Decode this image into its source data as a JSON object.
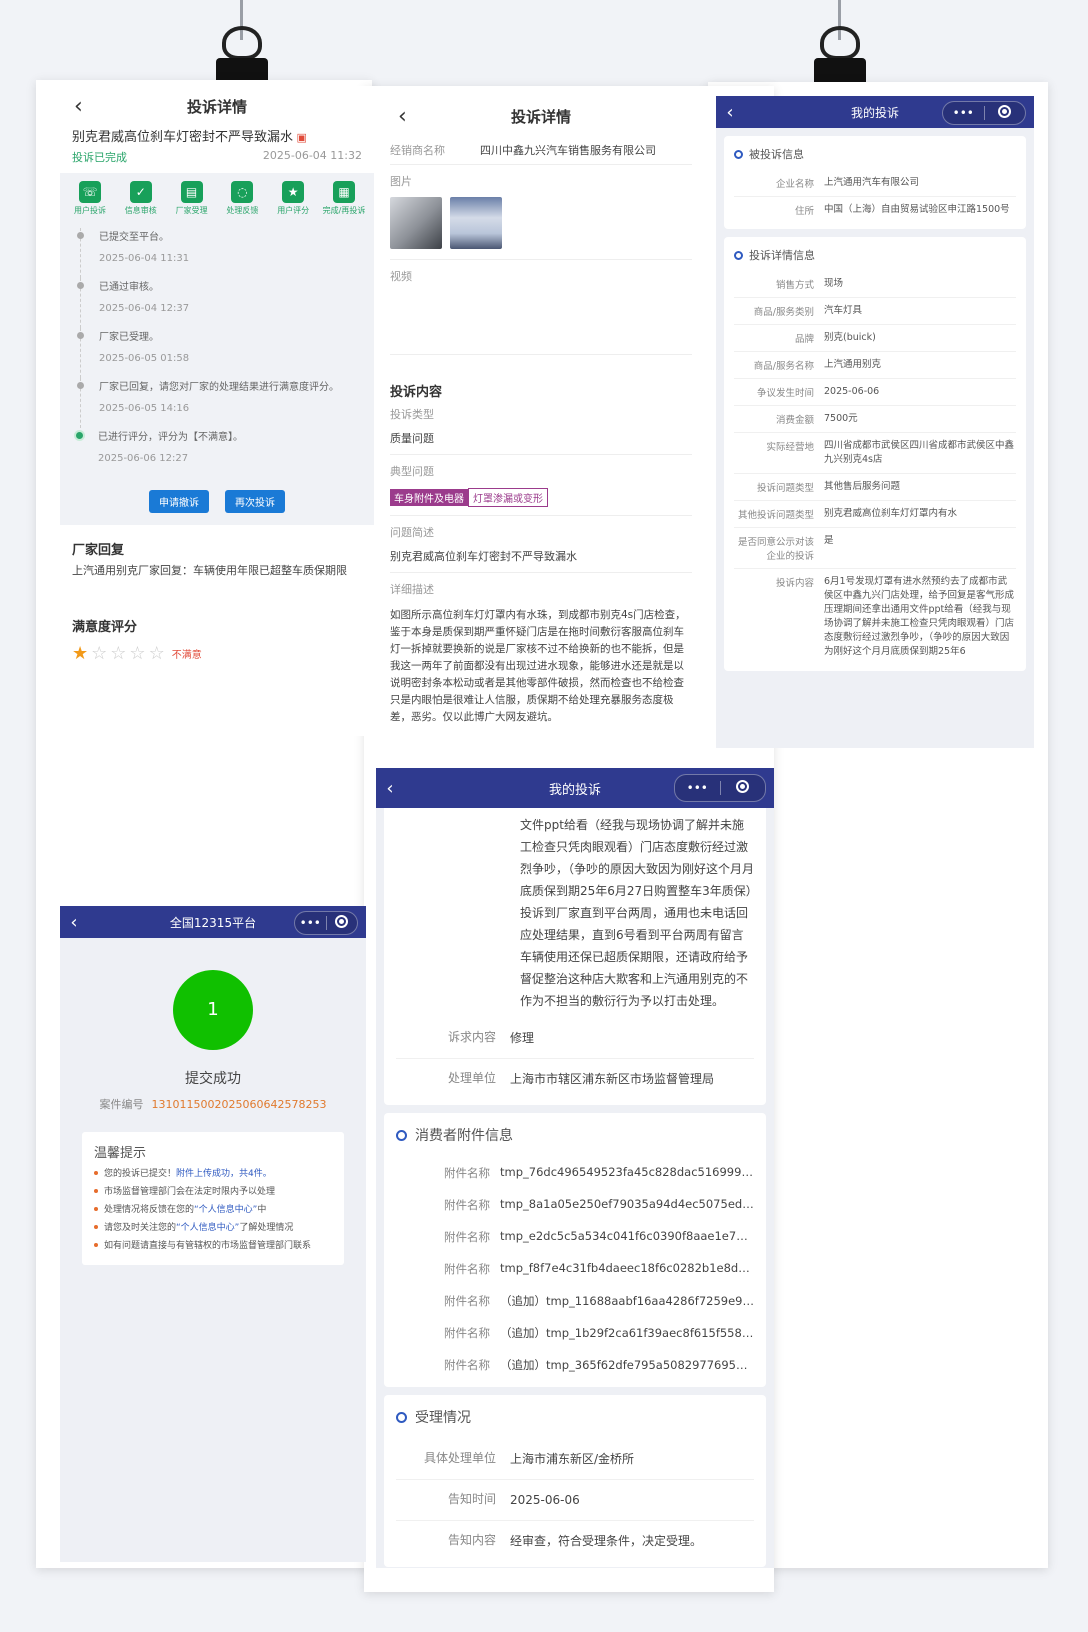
{
  "panel_a": {
    "title": "投诉详情",
    "subject": "别克君威高位刹车灯密封不严导致漏水",
    "status": "投诉已完成",
    "date": "2025-06-04 11:32",
    "steps": [
      "用户投诉",
      "信息审核",
      "厂家受理",
      "处理反馈",
      "用户评分",
      "完成/再投诉"
    ],
    "timeline": [
      {
        "text": "已提交至平台。",
        "time": "2025-06-04 11:31"
      },
      {
        "text": "已通过审核。",
        "time": "2025-06-04 12:37"
      },
      {
        "text": "厂家已受理。",
        "time": "2025-06-05 01:58"
      },
      {
        "text": "厂家已回复，请您对厂家的处理结果进行满意度评分。",
        "time": "2025-06-05 14:16"
      },
      {
        "text": "已进行评分，评分为【不满意】。",
        "time": "2025-06-06 12:27"
      }
    ],
    "btn_apply": "申请撤诉",
    "btn_again": "再次投诉",
    "reply_title": "厂家回复",
    "reply_text": "上汽通用别克厂家回复：车辆使用年限已超整车质保期限",
    "rating_title": "满意度评分",
    "rating_value": 1,
    "rating_max": 5,
    "rating_label": "不满意"
  },
  "panel_b": {
    "title": "投诉详情",
    "dealer_label": "经销商名称",
    "dealer": "四川中鑫九兴汽车销售服务有限公司",
    "images_label": "图片",
    "video_label": "视频",
    "content_title": "投诉内容",
    "type_label": "投诉类型",
    "type": "质量问题",
    "typical_label": "典型问题",
    "tag1": "车身附件及电器",
    "tag2": "灯罩渗漏或变形",
    "brief_label": "问题简述",
    "brief": "别克君威高位刹车灯密封不严导致漏水",
    "detail_label": "详细描述",
    "detail": "如图所示高位刹车灯灯罩内有水珠，到成都市别克4s门店检查，鉴于本身是质保到期严重怀疑门店是在拖时间敷衍客服高位刹车灯一拆掉就要换新的说是厂家核不过不给换新的也不能拆，但是我这一两年了前面都没有出现过进水现象，能够进水还是就是以说明密封条本松动或者是其他零部件破损，然而检查也不给检查只是内眼怕是很难让人信服，质保期不给处理充暴服务态度极差，恶劣。仅以此博广大网友避坑。"
  },
  "panel_c": {
    "nav_title": "我的投诉",
    "section1": "被投诉信息",
    "company_label": "企业名称",
    "company": "上汽通用汽车有限公司",
    "address_label": "住所",
    "address": "中国（上海）自由贸易试验区申江路1500号",
    "section2": "投诉详情信息",
    "rows": [
      {
        "k": "销售方式",
        "v": "现场"
      },
      {
        "k": "商品/服务类别",
        "v": "汽车灯具"
      },
      {
        "k": "品牌",
        "v": "别克(buick)"
      },
      {
        "k": "商品/服务名称",
        "v": "上汽通用别克"
      },
      {
        "k": "争议发生时间",
        "v": "2025-06-06"
      },
      {
        "k": "消费金额",
        "v": "7500元"
      },
      {
        "k": "实际经营地",
        "v": "四川省成都市武侯区四川省成都市武侯区中鑫九兴别克4s店"
      },
      {
        "k": "投诉问题类型",
        "v": "其他售后服务问题"
      },
      {
        "k": "其他投诉问题类型",
        "v": "别克君威高位刹车灯灯罩内有水"
      },
      {
        "k": "是否同意公示对该企业的投诉",
        "v": "是"
      },
      {
        "k": "投诉内容",
        "v": "6月1号发现灯罩有进水然预约去了成都市武侯区中鑫九兴门店处理，给予回复是客气形成压理期间还拿出通用文件ppt给看（经我与现场协调了解并未施工检查只凭肉眼观看）门店态度敷衍经过激烈争吵，（争吵的原因大致因为刚好这个月月底质保到期25年6"
      }
    ]
  },
  "panel_d": {
    "nav_title": "我的投诉",
    "long_text": "文件ppt给看（经我与现场协调了解并未施工检查只凭肉眼观看）门店态度敷衍经过激烈争吵，（争吵的原因大致因为刚好这个月月底质保到期25年6月27日购置整车3年质保）投诉到厂家直到平台两周，通用也未电话回应处理结果，直到6号看到平台两周有留言车辆使用还保已超质保期限，还请政府给予督促整治这种店大欺客和上汽通用别克的不作为不担当的敷衍行为予以打击处理。",
    "demand_label": "诉求内容",
    "demand": "修理",
    "unit_label": "处理单位",
    "unit": "上海市市辖区浦东新区市场监督管理局",
    "attach_title": "消费者附件信息",
    "attach_label": "附件名称",
    "attachments": [
      "tmp_76dc496549523fa45c828dac5169996df12...",
      "tmp_8a1a05e250ef79035a94d4ec5075ed856cd...",
      "tmp_e2dc5c5a534c041f6c0390f8aae1e70b8ad...",
      "tmp_f8f7e4c31fb4daeec18f6c0282b1e8d5c2ce...",
      "（追加）tmp_11688aabf16aa4286f7259e9a...",
      "（追加）tmp_1b29f2ca61f39aec8f615f5582...",
      "（追加）tmp_365f62dfe795a5082977695060..."
    ],
    "accept_title": "受理情况",
    "accept_unit_label": "具体处理单位",
    "accept_unit": "上海市浦东新区/金桥所",
    "notify_time_label": "告知时间",
    "notify_time": "2025-06-06",
    "notify_content_label": "告知内容",
    "notify_content": "经审查，符合受理条件，决定受理。"
  },
  "panel_e": {
    "nav_title": "全国12315平台",
    "circle_text": "1",
    "success": "提交成功",
    "case_label": "案件编号",
    "case_no": "1310115002025060642578253",
    "tip_title": "温馨提示",
    "tip1_a": "您的投诉已提交！",
    "tip1_b": "附件上传成功，",
    "tip1_c": "共4件。",
    "tip2": "市场监督管理部门会在法定时限内予以处理",
    "tip3_a": "处理情况将反馈在您的",
    "tip3_b": "“个人信息中心”",
    "tip3_c": "中",
    "tip4_a": "请您及时关注您的",
    "tip4_b": "“个人信息中心”",
    "tip4_c": "了解处理情况",
    "tip5": "如有问题请直接与有管辖权的市场监督管理部门联系"
  },
  "icons": {
    "back": "‹",
    "more": "•••"
  }
}
